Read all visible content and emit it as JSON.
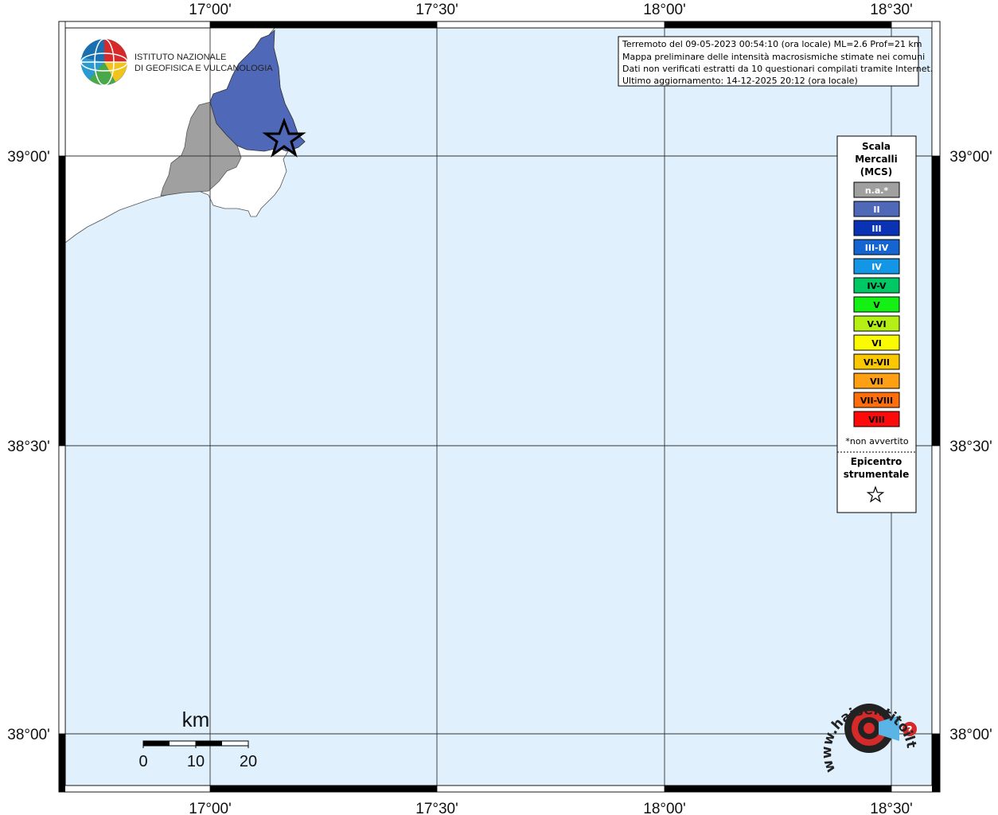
{
  "map": {
    "lon_labels": [
      "17°00'",
      "17°30'",
      "18°00'",
      "18°30'"
    ],
    "lat_labels": [
      "39°00'",
      "38°30'",
      "38°00'"
    ],
    "colors": {
      "sea": "#e0f0fc",
      "land": "#ffffff",
      "grid": "#333333"
    }
  },
  "info_box": {
    "lines": [
      "Terremoto del 09-05-2023 00:54:10 (ora locale) ML=2.6 Prof=21 km",
      "Mappa preliminare delle intensità macrosismiche stimate nei comuni",
      "Dati non verificati estratti da 10 questionari compilati tramite Internet.",
      "Ultimo aggiornamento: 14-12-2025 20:12 (ora locale)"
    ]
  },
  "logo": {
    "line1": "ISTITUTO NAZIONALE",
    "line2": "DI GEOFISICA E VULCANOLOGIA"
  },
  "legend": {
    "title": [
      "Scala",
      "Mercalli",
      "(MCS)"
    ],
    "classes": [
      {
        "label": "n.a.*",
        "color": "#a0a0a0",
        "text": "#ffffff"
      },
      {
        "label": "II",
        "color": "#5068b8",
        "text": "#ffffff"
      },
      {
        "label": "III",
        "color": "#0a32b4",
        "text": "#ffffff"
      },
      {
        "label": "III-IV",
        "color": "#1464d2",
        "text": "#ffffff"
      },
      {
        "label": "IV",
        "color": "#1496e6",
        "text": "#ffffff"
      },
      {
        "label": "IV-V",
        "color": "#00c864",
        "text": "#000000"
      },
      {
        "label": "V",
        "color": "#14f014",
        "text": "#000000"
      },
      {
        "label": "V-VI",
        "color": "#b4f014",
        "text": "#000000"
      },
      {
        "label": "VI",
        "color": "#fafa00",
        "text": "#000000"
      },
      {
        "label": "VI-VII",
        "color": "#fac800",
        "text": "#000000"
      },
      {
        "label": "VII",
        "color": "#ffa014",
        "text": "#000000"
      },
      {
        "label": "VII-VIII",
        "color": "#ff6e0a",
        "text": "#000000"
      },
      {
        "label": "VIII",
        "color": "#ff0a0a",
        "text": "#000000"
      }
    ],
    "note": "*non avvertito",
    "epicenter_title": [
      "Epicentro",
      "strumentale"
    ],
    "epicenter_symbol": "star-icon"
  },
  "scale_bar": {
    "unit": "km",
    "ticks": [
      "0",
      "10",
      "20"
    ]
  },
  "watermark": {
    "text": "www.haisentitoilterremoto.it"
  }
}
